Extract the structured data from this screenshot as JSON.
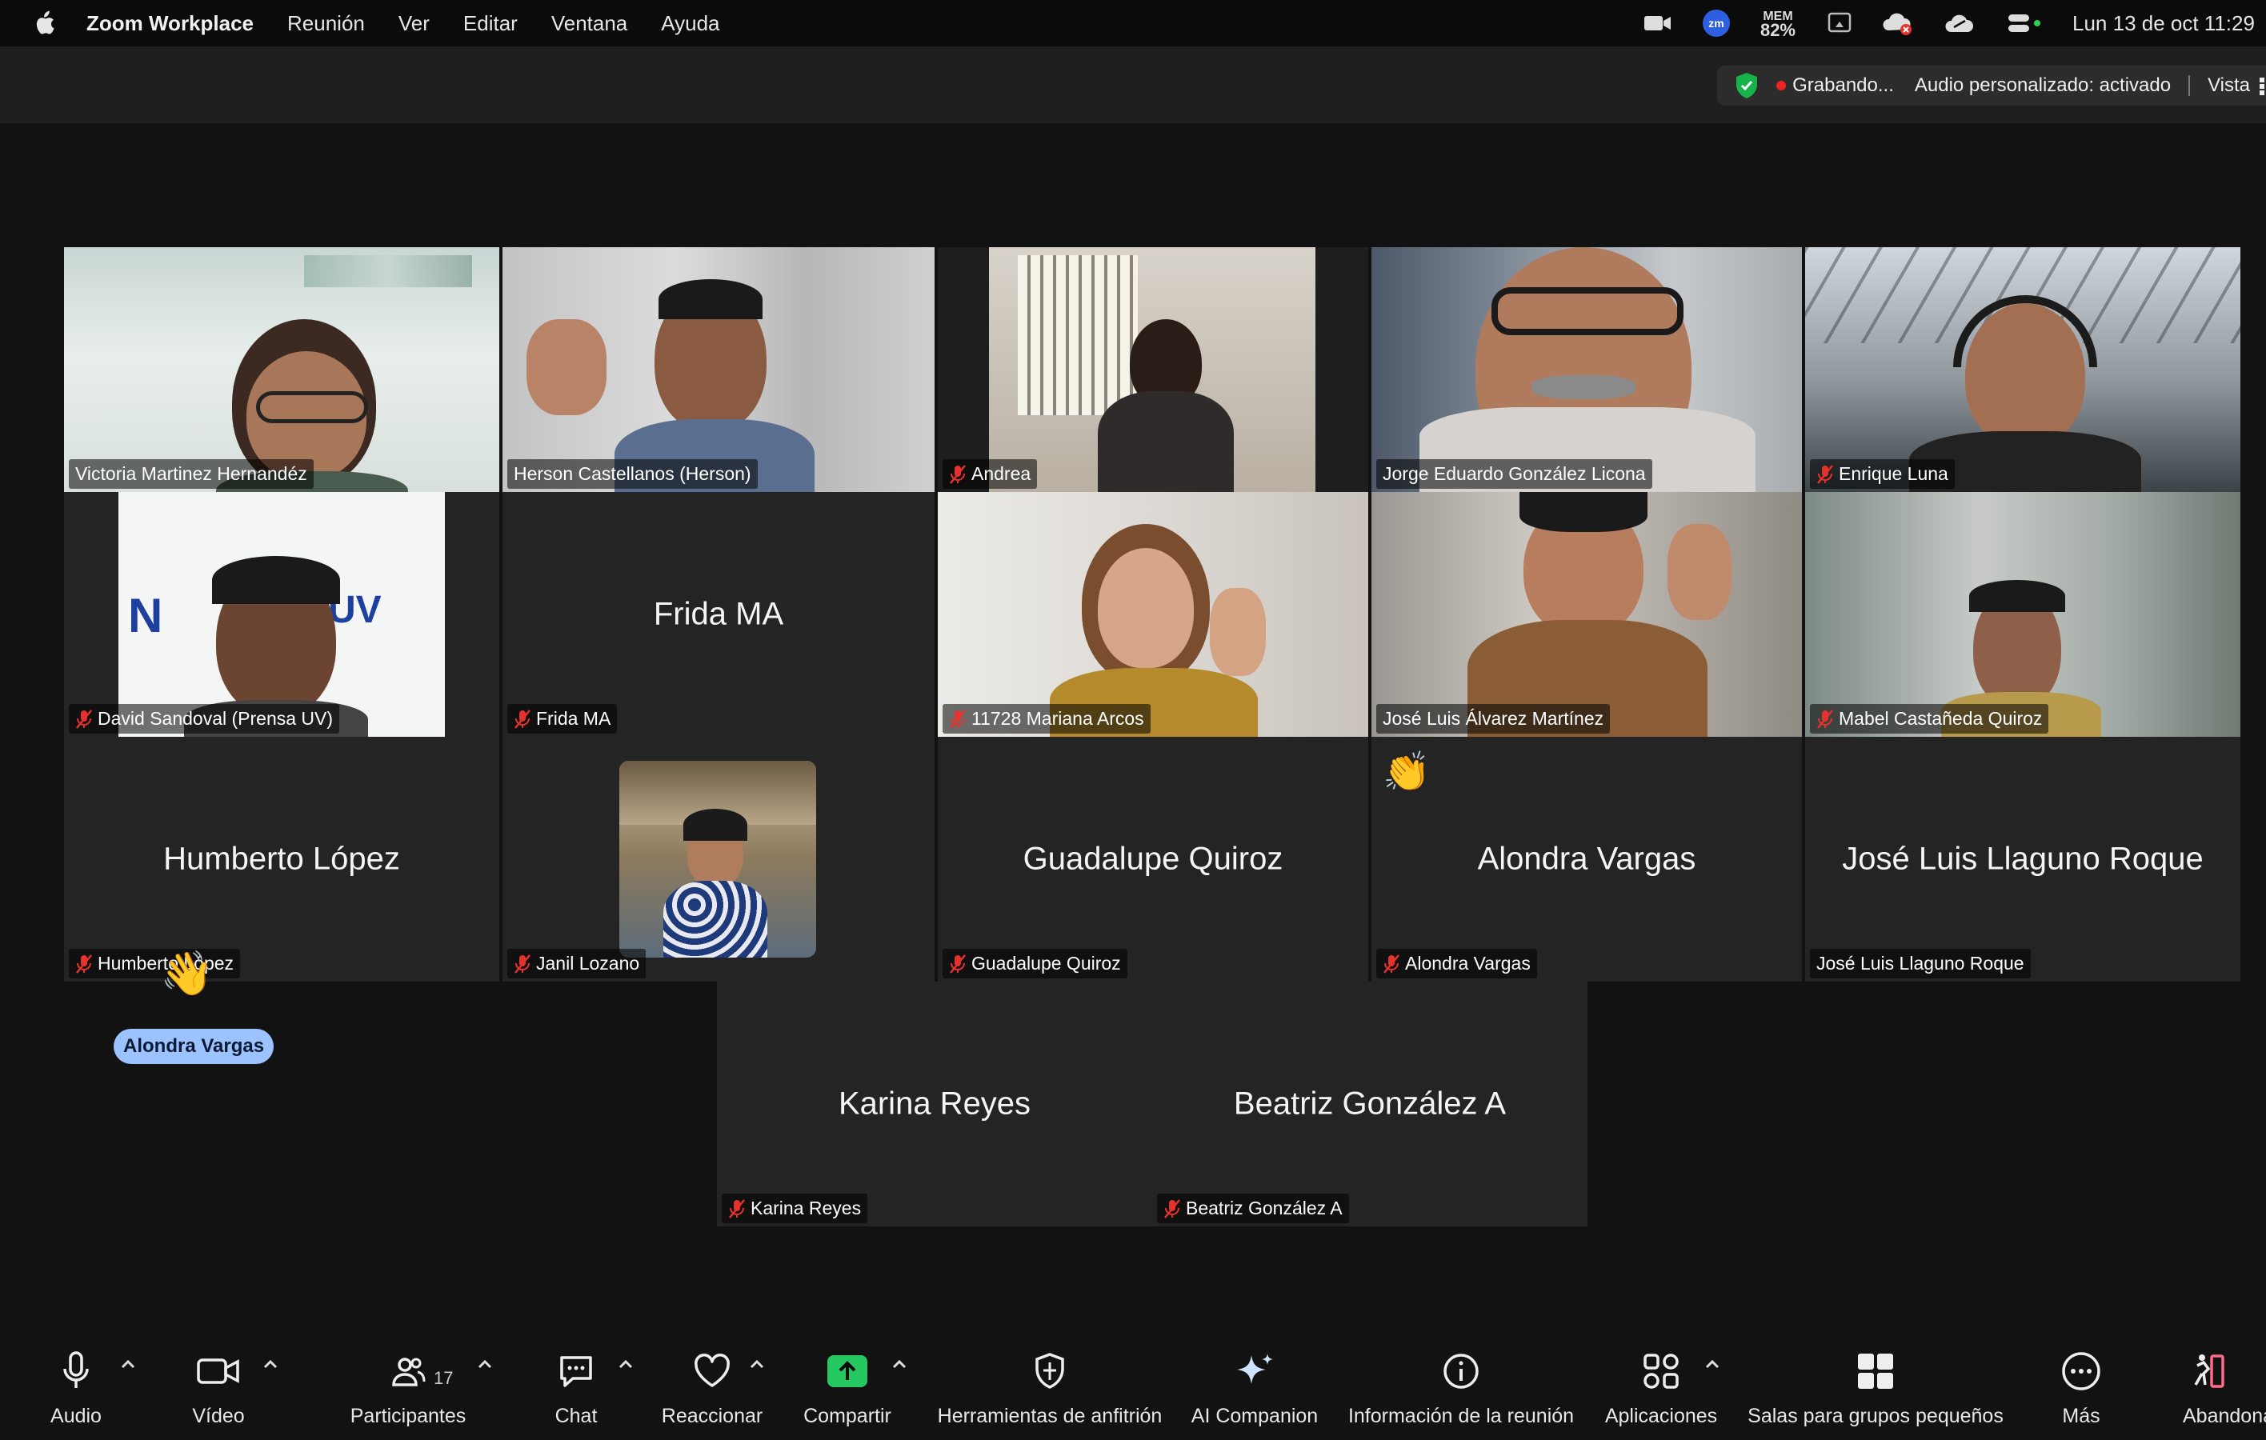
{
  "menubar": {
    "app_name": "Zoom Workplace",
    "menus": [
      "Reunión",
      "Ver",
      "Editar",
      "Ventana",
      "Ayuda"
    ],
    "memory_label": "MEM",
    "memory_value": "82%",
    "zm_badge": "zm",
    "clock": "Lun 13 de oct  11:29"
  },
  "topbar": {
    "recording": "Grabando...",
    "audio": "Audio personalizado: activado",
    "view": "Vista"
  },
  "participants": [
    {
      "name": "Victoria Martinez Hernandéz",
      "muted": false,
      "video": true
    },
    {
      "name": "Herson Castellanos (Herson)",
      "muted": false,
      "video": true
    },
    {
      "name": "Andrea",
      "muted": true,
      "video": true
    },
    {
      "name": "Jorge Eduardo González Licona",
      "muted": false,
      "video": true
    },
    {
      "name": "Enrique Luna",
      "muted": true,
      "video": true
    },
    {
      "name": "David Sandoval (Prensa UV)",
      "muted": true,
      "video": true
    },
    {
      "name": "Frida MA",
      "muted": true,
      "video": false
    },
    {
      "name": "11728 Mariana Arcos",
      "muted": true,
      "video": true
    },
    {
      "name": "José Luis Álvarez Martínez",
      "muted": false,
      "video": true
    },
    {
      "name": "Mabel Castañeda Quiroz",
      "muted": true,
      "video": true
    },
    {
      "name": "Humberto López",
      "muted": true,
      "video": false
    },
    {
      "name": "Janil Lozano",
      "muted": true,
      "video": false
    },
    {
      "name": "Guadalupe Quiroz",
      "muted": true,
      "video": false
    },
    {
      "name": "Alondra Vargas",
      "muted": true,
      "video": false
    },
    {
      "name": "José Luis Llaguno Roque",
      "muted": false,
      "video": false
    },
    {
      "name": "Karina Reyes",
      "muted": true,
      "video": false
    },
    {
      "name": "Beatriz González A",
      "muted": true,
      "video": false
    }
  ],
  "david_banner_text": "UV",
  "reaction_label": "Alondra Vargas",
  "toolbar": {
    "audio": "Audio",
    "video": "Vídeo",
    "participants": "Participantes",
    "participants_count": "17",
    "chat": "Chat",
    "react": "Reaccionar",
    "share": "Compartir",
    "host_tools": "Herramientas de anfitrión",
    "ai_companion": "AI Companion",
    "meeting_info": "Información de la reunión",
    "apps": "Aplicaciones",
    "breakout": "Salas para grupos pequeños",
    "more": "Más",
    "leave": "Abandonar"
  },
  "colors": {
    "active_speaker": "#2dd155",
    "share_green": "#24c760",
    "tile_bg": "#242424",
    "mute_red": "#e5322d"
  }
}
